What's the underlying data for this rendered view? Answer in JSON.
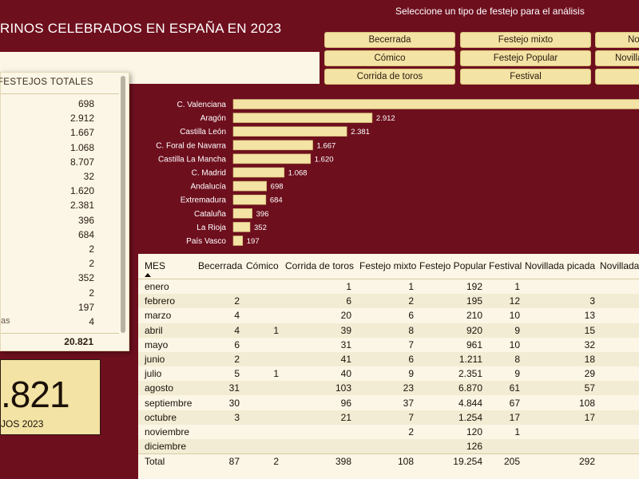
{
  "header": {
    "title": "RINOS CELEBRADOS EN ESPAÑA EN 2023",
    "filter_caption": "Seleccione un tipo de festejo para el análisis"
  },
  "filters": [
    {
      "label": "Becerrada"
    },
    {
      "label": "Festejo mixto"
    },
    {
      "label": "Novillada picada"
    },
    {
      "label": "Cómico"
    },
    {
      "label": "Festejo Popular"
    },
    {
      "label": "Novillada sin picadores"
    },
    {
      "label": "Corrida de toros"
    },
    {
      "label": "Festival"
    },
    {
      "label": ""
    }
  ],
  "left_table": {
    "header": "FESTEJOS TOTALES",
    "rows": [
      {
        "label": "",
        "value": "698"
      },
      {
        "label": "",
        "value": "2.912"
      },
      {
        "label": "",
        "value": "1.667"
      },
      {
        "label": "",
        "value": "1.068"
      },
      {
        "label": "",
        "value": "8.707"
      },
      {
        "label": "",
        "value": "32"
      },
      {
        "label": "",
        "value": "1.620"
      },
      {
        "label": "",
        "value": "2.381"
      },
      {
        "label": "",
        "value": "396"
      },
      {
        "label": "",
        "value": "684"
      },
      {
        "label": "",
        "value": "2"
      },
      {
        "label": "",
        "value": "2"
      },
      {
        "label": "",
        "value": "352"
      },
      {
        "label": "",
        "value": "2"
      },
      {
        "label": "",
        "value": "197"
      },
      {
        "label": "as",
        "value": "4"
      }
    ],
    "total": "20.821"
  },
  "kpi": {
    "value": ".821",
    "label": "JOS 2023"
  },
  "chart_data": {
    "type": "bar",
    "orientation": "horizontal",
    "categories": [
      "C. Valenciana",
      "Aragón",
      "Castilla León",
      "C. Foral de Navarra",
      "Castilla La Mancha",
      "C. Madrid",
      "Andalucía",
      "Extremadura",
      "Cataluña",
      "La Rioja",
      "País Vasco"
    ],
    "values": [
      8707,
      2912,
      2381,
      1667,
      1620,
      1068,
      698,
      684,
      396,
      352,
      197
    ],
    "labels": [
      "",
      "2.912",
      "2.381",
      "1.667",
      "1.620",
      "1.068",
      "698",
      "684",
      "396",
      "352",
      "197"
    ],
    "colors": {
      "bar": "#f3e3a4",
      "bar_border": "#cbb46a",
      "text": "#ffffff"
    }
  },
  "month_table": {
    "columns": [
      "MES",
      "Becerrada",
      "Cómico",
      "Corrida de toros",
      "Festejo mixto",
      "Festejo Popular",
      "Festival",
      "Novillada picada",
      "Novillada"
    ],
    "rows": [
      [
        "enero",
        "",
        "",
        "1",
        "1",
        "192",
        "1",
        "",
        ""
      ],
      [
        "febrero",
        "2",
        "",
        "6",
        "2",
        "195",
        "12",
        "3",
        ""
      ],
      [
        "marzo",
        "4",
        "",
        "20",
        "6",
        "210",
        "10",
        "13",
        ""
      ],
      [
        "abril",
        "4",
        "1",
        "39",
        "8",
        "920",
        "9",
        "15",
        ""
      ],
      [
        "mayo",
        "6",
        "",
        "31",
        "7",
        "961",
        "10",
        "32",
        ""
      ],
      [
        "junio",
        "2",
        "",
        "41",
        "6",
        "1.211",
        "8",
        "18",
        ""
      ],
      [
        "julio",
        "5",
        "1",
        "40",
        "9",
        "2.351",
        "9",
        "29",
        ""
      ],
      [
        "agosto",
        "31",
        "",
        "103",
        "23",
        "6.870",
        "61",
        "57",
        ""
      ],
      [
        "septiembre",
        "30",
        "",
        "96",
        "37",
        "4.844",
        "67",
        "108",
        ""
      ],
      [
        "octubre",
        "3",
        "",
        "21",
        "7",
        "1.254",
        "17",
        "17",
        ""
      ],
      [
        "noviembre",
        "",
        "",
        "",
        "2",
        "120",
        "1",
        "",
        ""
      ],
      [
        "diciembre",
        "",
        "",
        "",
        "",
        "126",
        "",
        "",
        ""
      ]
    ],
    "total": [
      "Total",
      "87",
      "2",
      "398",
      "108",
      "19.254",
      "205",
      "292",
      ""
    ]
  }
}
